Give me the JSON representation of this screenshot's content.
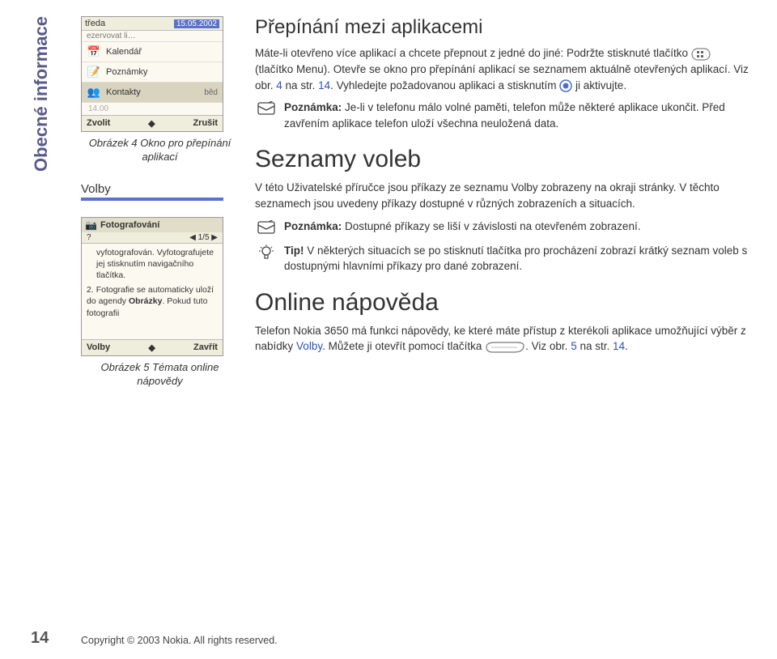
{
  "sidebar_tab": "Obecné informace",
  "page_number": "14",
  "footer": "Copyright © 2003 Nokia. All rights reserved.",
  "fig4": {
    "top_day": "tředa",
    "top_date": "15.05.2002",
    "top_sub": "ezervovat li…",
    "items": [
      {
        "icon": "calendar",
        "label": "Kalendář"
      },
      {
        "icon": "notes",
        "label": "Poznámky"
      },
      {
        "icon": "contacts",
        "label": "Kontakty"
      }
    ],
    "detail": "běd",
    "time1": "",
    "time2": "14.00",
    "softleft": "Zvolit",
    "softright": "Zrušit",
    "caption": "Obrázek 4 Okno pro přepínání aplikací"
  },
  "volby_heading": "Volby",
  "fig5": {
    "header_title": "Fotografování",
    "header_sub": "1/5",
    "body_lines": [
      "vyfotografován. Vyfotografujete jej stisknutím navigačního tlačítka.",
      "2. Fotografie se automaticky uloží do agendy Obrázky. Pokud tuto fotografii"
    ],
    "softleft": "Volby",
    "softright": "Zavřít",
    "caption": "Obrázek 5 Témata online nápovědy"
  },
  "main": {
    "h1": "Přepínání mezi aplikacemi",
    "p1a": "Máte-li otevřeno více aplikací a chcete přepnout z jedné do jiné: Podržte stisknuté tlačítko ",
    "p1b": " (tlačítko Menu). Otevře se okno pro přepínání aplikací se seznamem aktuálně otevřených aplikací. Viz obr. ",
    "link4": "4",
    "p1c": " na str. ",
    "link14a": "14",
    "p1d": ". Vyhledejte požadovanou aplikaci a stisknutím ",
    "p1e": " ji aktivujte.",
    "note1_label": "Poznámka:",
    "note1": " Je-li v telefonu málo volné paměti, telefon může některé aplikace ukončit. Před zavřením aplikace telefon uloží všechna neuložená data.",
    "h2": "Seznamy voleb",
    "p2": "V této Uživatelské příručce jsou příkazy ze seznamu Volby zobrazeny na okraji stránky. V těchto seznamech jsou uvedeny příkazy dostupné v různých zobrazeních a situacích.",
    "note2_label": "Poznámka:",
    "note2": " Dostupné příkazy se liší v závislosti na otevřeném zobrazení.",
    "tip_label": "Tip!",
    "tip": " V některých situacích se po stisknutí tlačítka pro procházení zobrazí krátký seznam voleb s dostupnými hlavními příkazy pro dané zobrazení.",
    "h3": "Online nápověda",
    "p3a": "Telefon Nokia 3650 má funkci nápovědy, ke které máte přístup z kterékoli aplikace umožňující výběr z nabídky ",
    "p3_volby": "Volby",
    "p3b": ". Můžete ji otevřít pomocí tlačítka ",
    "p3c": ". Viz obr. ",
    "link5": "5",
    "p3d": " na str. ",
    "link14b": "14",
    "p3e": "."
  }
}
